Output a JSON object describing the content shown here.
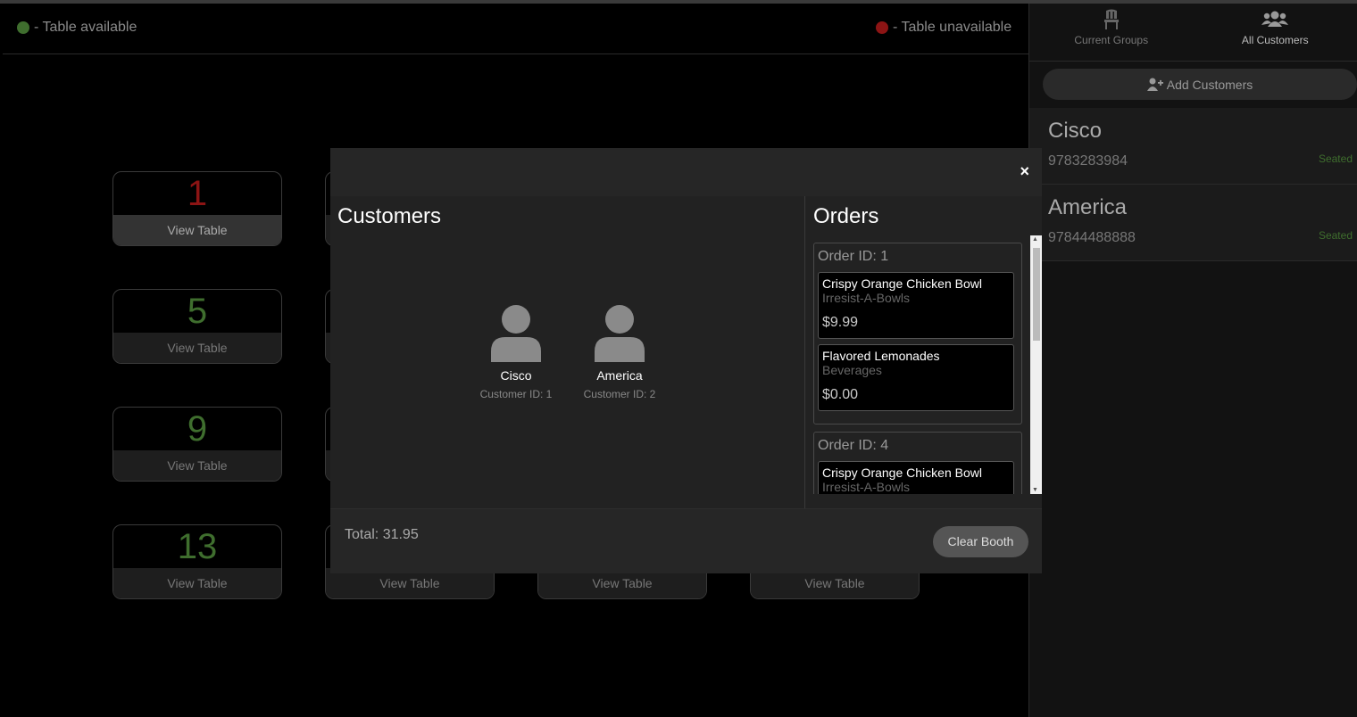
{
  "legend": {
    "available": "- Table available",
    "unavailable": "- Table unavailable"
  },
  "tables": [
    {
      "number": "1",
      "status": "unavailable",
      "view": "View Table"
    },
    {
      "number": "5",
      "status": "available",
      "view": "View Table"
    },
    {
      "number": "9",
      "status": "available",
      "view": "View Table"
    },
    {
      "number": "13",
      "status": "available",
      "view": "View Table"
    },
    {
      "number": "",
      "status": "available",
      "view": "View Table"
    },
    {
      "number": "",
      "status": "available",
      "view": "View Table"
    },
    {
      "number": "",
      "status": "available",
      "view": "View Table"
    }
  ],
  "sidebar": {
    "tabs": [
      {
        "label": "Current Groups",
        "icon": "chair-icon"
      },
      {
        "label": "All Customers",
        "icon": "users-icon"
      }
    ],
    "add_button": "Add Customers",
    "customers": [
      {
        "name": "Cisco",
        "phone": "9783283984",
        "status": "Seated"
      },
      {
        "name": "America",
        "phone": "97844488888",
        "status": "Seated"
      }
    ]
  },
  "modal": {
    "close": "×",
    "customers_title": "Customers",
    "orders_title": "Orders",
    "customers": [
      {
        "name": "Cisco",
        "id_label": "Customer ID: 1"
      },
      {
        "name": "America",
        "id_label": "Customer ID: 2"
      }
    ],
    "orders": [
      {
        "id_label": "Order ID: 1",
        "items": [
          {
            "name": "Crispy Orange Chicken Bowl",
            "category": "Irresist-A-Bowls",
            "price": "$9.99"
          },
          {
            "name": "Flavored Lemonades",
            "category": "Beverages",
            "price": "$0.00"
          }
        ]
      },
      {
        "id_label": "Order ID: 4",
        "items": [
          {
            "name": "Crispy Orange Chicken Bowl",
            "category": "Irresist-A-Bowls",
            "price": ""
          }
        ]
      }
    ],
    "total": "Total: 31.95",
    "clear_button": "Clear Booth"
  }
}
